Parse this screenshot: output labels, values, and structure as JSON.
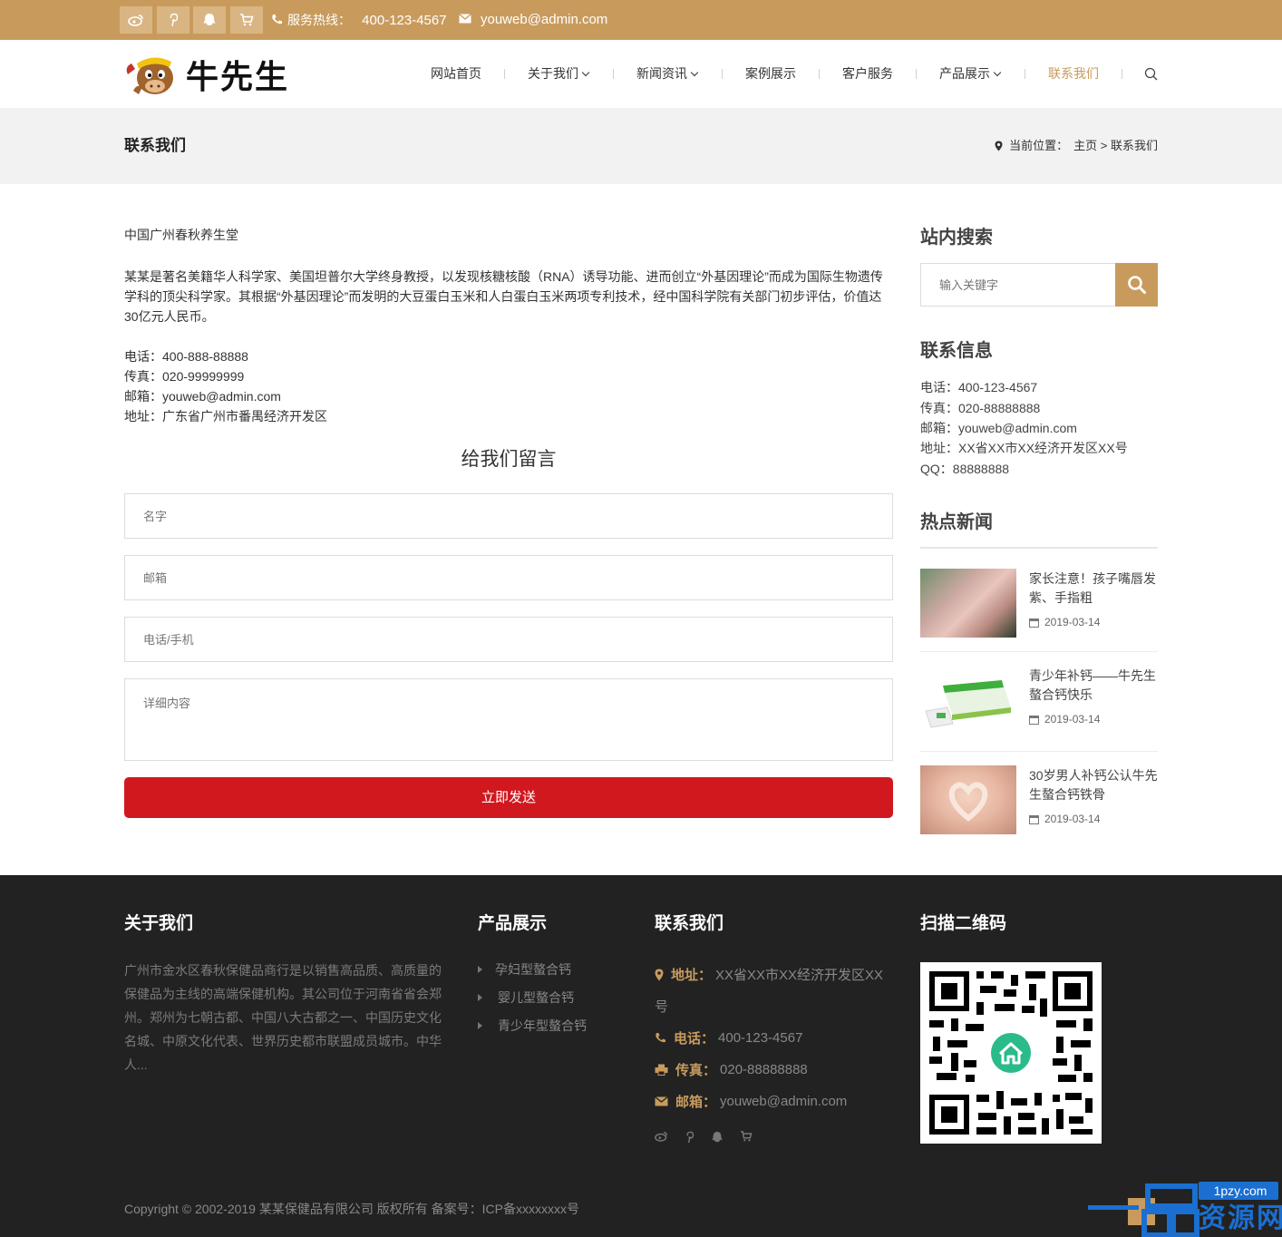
{
  "topbar": {
    "icons": [
      "weibo-icon",
      "pinterest-icon",
      "qq-icon",
      "cart-icon"
    ],
    "hotline_label": "服务热线：",
    "hotline": "400-123-4567",
    "email": "youweb@admin.com"
  },
  "header": {
    "logo_text": "牛先生",
    "nav": [
      {
        "label": "网站首页"
      },
      {
        "label": "关于我们"
      },
      {
        "label": "新闻资讯"
      },
      {
        "label": "案例展示"
      },
      {
        "label": "客户服务"
      },
      {
        "label": "产品展示"
      },
      {
        "label": "联系我们"
      }
    ]
  },
  "band": {
    "title": "联系我们",
    "crumb_label": "当前位置：",
    "crumb_home": "主页",
    "crumb_sep": " > ",
    "crumb_current": "联系我们"
  },
  "content": {
    "company": "中国广州春秋养生堂",
    "description": "某某是著名美籍华人科学家、美国坦普尔大学终身教授，以发现核糖核酸（RNA）诱导功能、进而创立“外基因理论”而成为国际生物遗传学科的顶尖科学家。其根据“外基因理论”而发明的大豆蛋白玉米和人白蛋白玉米两项专利技术，经中国科学院有关部门初步评估，价值达30亿元人民币。",
    "phone": "电话：400-888-88888",
    "fax": "传真：020-99999999",
    "email": "邮箱：youweb@admin.com",
    "address": "地址：广东省广州市番禺经济开发区"
  },
  "form": {
    "title": "给我们留言",
    "name_placeholder": "名字",
    "email_placeholder": "邮箱",
    "phone_placeholder": "电话/手机",
    "content_placeholder": "详细内容",
    "submit_label": "立即发送"
  },
  "sidebar": {
    "search_title": "站内搜索",
    "search_placeholder": "输入关键字",
    "contact_title": "联系信息",
    "contact": {
      "phone": "电话：400-123-4567",
      "fax": "传真：020-88888888",
      "email": "邮箱：youweb@admin.com",
      "address": "地址：XX省XX市XX经济开发区XX号",
      "qq": "QQ：88888888"
    },
    "news_title": "热点新闻",
    "news": [
      {
        "title": "家长注意！孩子嘴唇发紫、手指粗",
        "date": "2019-03-14"
      },
      {
        "title": "青少年补钙——牛先生螯合钙快乐",
        "date": "2019-03-14"
      },
      {
        "title": "30岁男人补钙公认牛先生螯合钙铁骨",
        "date": "2019-03-14"
      }
    ]
  },
  "footer": {
    "about_title": "关于我们",
    "about_text": "广州市金水区春秋保健品商行是以销售高品质、高质量的保健品为主线的高端保健机构。其公司位于河南省省会郑州。郑州为七朝古都、中国八大古都之一、中国历史文化名城、中原文化代表、世界历史都市联盟成员城市。中华人...",
    "products_title": "产品展示",
    "products": [
      "孕妇型螯合钙",
      "婴儿型螯合钙",
      "青少年型螯合钙"
    ],
    "contact_title": "联系我们",
    "address_label": "地址：",
    "address_line1": "XX省XX市XX经济开发区XX",
    "address_line2": "号",
    "phone_label": "电话：",
    "phone": "400-123-4567",
    "fax_label": "传真：",
    "fax": "020-88888888",
    "email_label": "邮箱：",
    "email": "youweb@admin.com",
    "qr_title": "扫描二维码",
    "copyright": "Copyright © 2002-2019 某某保健品有限公司 版权所有 备案号：ICP备xxxxxxxx号"
  },
  "watermark": {
    "site": "1pzy.com",
    "brand": "资源网"
  },
  "colors": {
    "accent": "#c89b5d",
    "button": "#d0181e",
    "footer_bg": "#222222",
    "band_bg": "#f2f2f2"
  }
}
